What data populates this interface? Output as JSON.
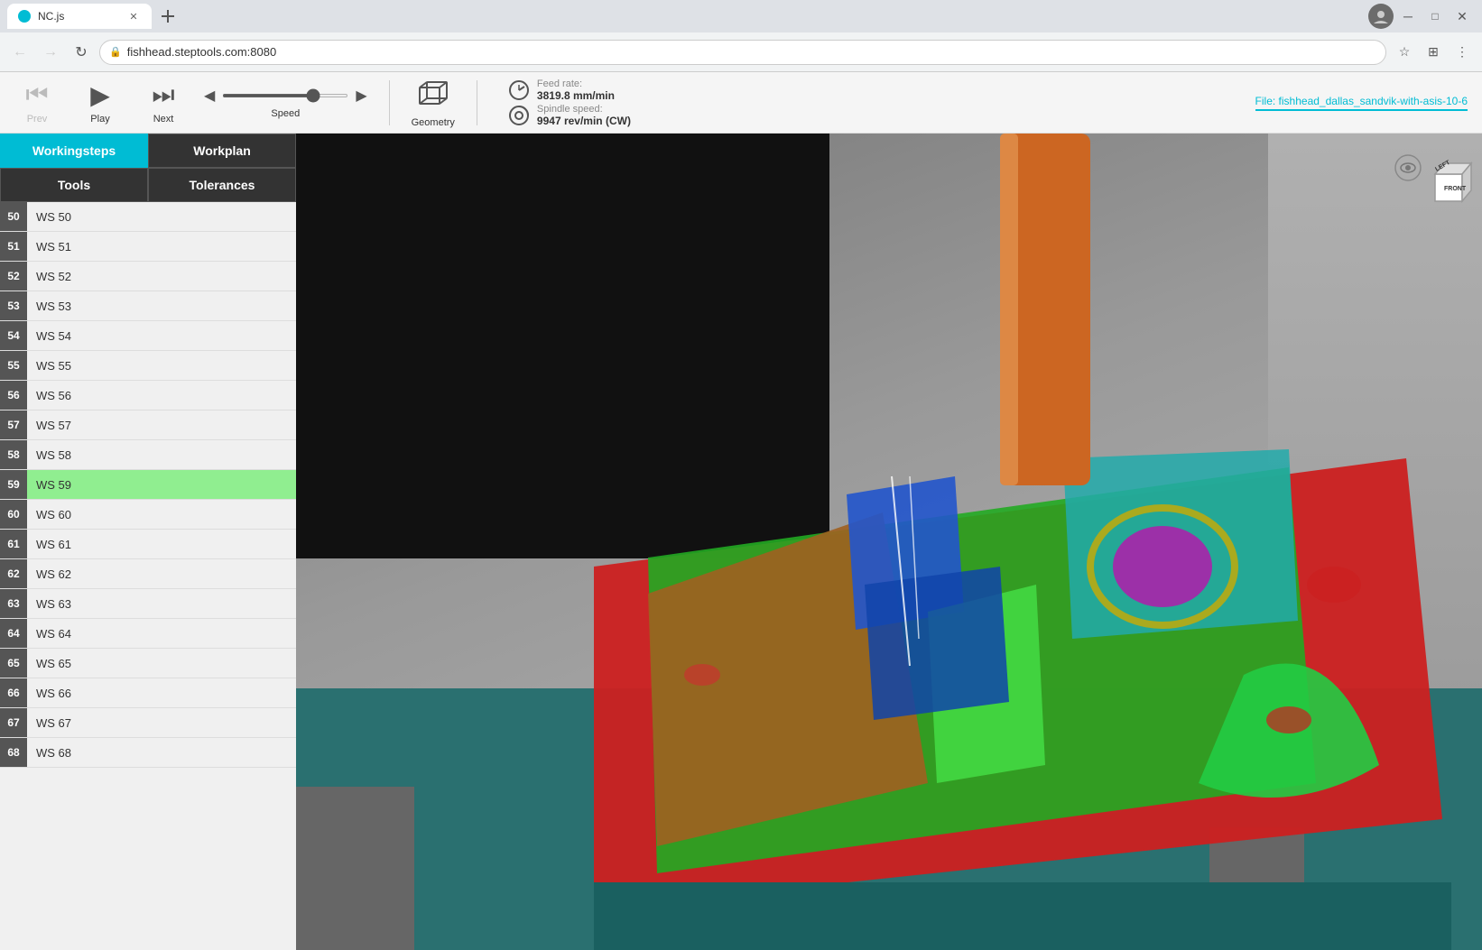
{
  "browser": {
    "tab_title": "NC.js",
    "address": "fishhead.steptools.com:8080",
    "back_disabled": true,
    "forward_disabled": true
  },
  "toolbar": {
    "prev_label": "Prev",
    "play_label": "Play",
    "next_label": "Next",
    "speed_label": "Speed",
    "geometry_label": "Geometry",
    "feed_rate_label": "Feed rate:",
    "feed_rate_value": "3819.8 mm/min",
    "spindle_speed_label": "Spindle speed:",
    "spindle_speed_value": "9947 rev/min (CW)",
    "file_link": "File: fishhead_dallas_sandvik-with-asis-10-6"
  },
  "sidebar": {
    "tab_workingsteps": "Workingsteps",
    "tab_workplan": "Workplan",
    "tab_tools": "Tools",
    "tab_tolerances": "Tolerances",
    "items": [
      {
        "num": 50,
        "label": "WS 50",
        "active": false
      },
      {
        "num": 51,
        "label": "WS 51",
        "active": false
      },
      {
        "num": 52,
        "label": "WS 52",
        "active": false
      },
      {
        "num": 53,
        "label": "WS 53",
        "active": false
      },
      {
        "num": 54,
        "label": "WS 54",
        "active": false
      },
      {
        "num": 55,
        "label": "WS 55",
        "active": false
      },
      {
        "num": 56,
        "label": "WS 56",
        "active": false
      },
      {
        "num": 57,
        "label": "WS 57",
        "active": false
      },
      {
        "num": 58,
        "label": "WS 58",
        "active": false
      },
      {
        "num": 59,
        "label": "WS 59",
        "active": true
      },
      {
        "num": 60,
        "label": "WS 60",
        "active": false
      },
      {
        "num": 61,
        "label": "WS 61",
        "active": false
      },
      {
        "num": 62,
        "label": "WS 62",
        "active": false
      },
      {
        "num": 63,
        "label": "WS 63",
        "active": false
      },
      {
        "num": 64,
        "label": "WS 64",
        "active": false
      },
      {
        "num": 65,
        "label": "WS 65",
        "active": false
      },
      {
        "num": 66,
        "label": "WS 66",
        "active": false
      },
      {
        "num": 67,
        "label": "WS 67",
        "active": false
      },
      {
        "num": 68,
        "label": "WS 68",
        "active": false
      }
    ]
  },
  "navcube": {
    "left_label": "LEFT",
    "front_label": "FRONT"
  }
}
